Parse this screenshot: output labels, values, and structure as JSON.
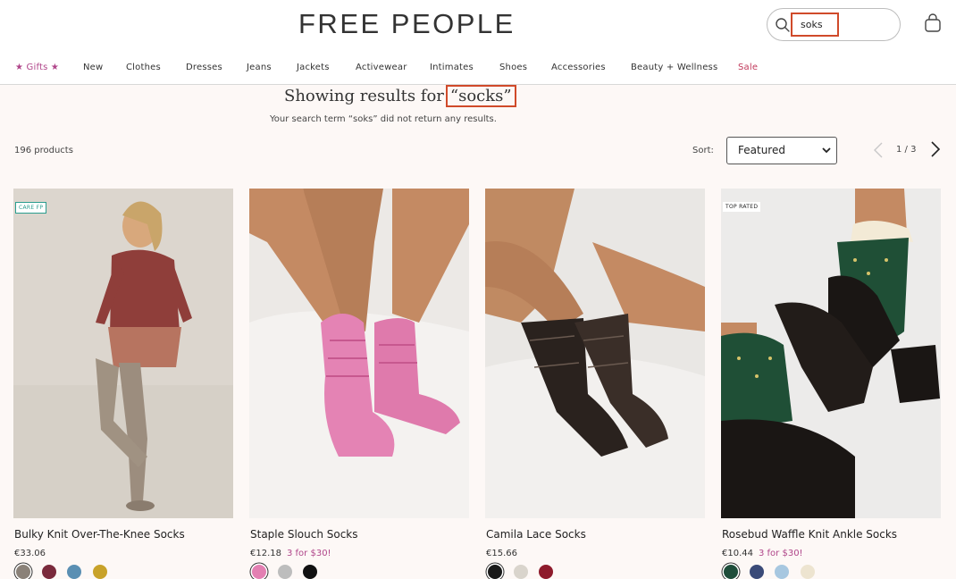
{
  "header": {
    "logo": "FREE PEOPLE",
    "search": {
      "value": "soks",
      "placeholder": ""
    },
    "icons": [
      "search-icon",
      "shopping-bag-icon"
    ]
  },
  "nav": {
    "items": [
      {
        "label": "★ Gifts ★",
        "color": "#b0468a"
      },
      {
        "label": "New"
      },
      {
        "label": "Clothes"
      },
      {
        "label": "Dresses"
      },
      {
        "label": "Jeans"
      },
      {
        "label": "Jackets"
      },
      {
        "label": "Activewear"
      },
      {
        "label": "Intimates"
      },
      {
        "label": "Shoes"
      },
      {
        "label": "Accessories"
      },
      {
        "label": "Beauty + Wellness"
      },
      {
        "label": "Sale",
        "color": "#c0385a"
      }
    ]
  },
  "results": {
    "heading_prefix": "Showing results for",
    "heading_term": "“socks”",
    "note": "Your search term “soks” did not return any results."
  },
  "toolbar": {
    "count": "196 products",
    "sort_label": "Sort:",
    "sort_value": "Featured",
    "pagination": "1 / 3"
  },
  "products": [
    {
      "name": "Bulky Knit Over-The-Knee Socks",
      "price": "€33.06",
      "promo": "",
      "badge": "CARE FP",
      "swatches": [
        "#8a8178",
        "#7a2a3c",
        "#5a8fb3",
        "#c8a22a"
      ]
    },
    {
      "name": "Staple Slouch Socks",
      "price": "€12.18",
      "promo": "3 for $30!",
      "badge": "",
      "swatches": [
        "#e37fb2",
        "#bdbdbd",
        "#111111"
      ]
    },
    {
      "name": "Camila Lace Socks",
      "price": "€15.66",
      "promo": "",
      "badge": "",
      "swatches": [
        "#1a1a1a",
        "#d9d4cc",
        "#8e1b2c"
      ]
    },
    {
      "name": "Rosebud Waffle Knit Ankle Socks",
      "price": "€10.44",
      "promo": "3 for $30!",
      "badge": "TOP RATED",
      "swatches": [
        "#1e4d3a",
        "#3a4a78",
        "#a7c7e0",
        "#ede4d0"
      ]
    }
  ],
  "colors": {
    "accent": "#b0468a",
    "highlight_box": "#d04a2a",
    "background": "#fdf8f6"
  }
}
